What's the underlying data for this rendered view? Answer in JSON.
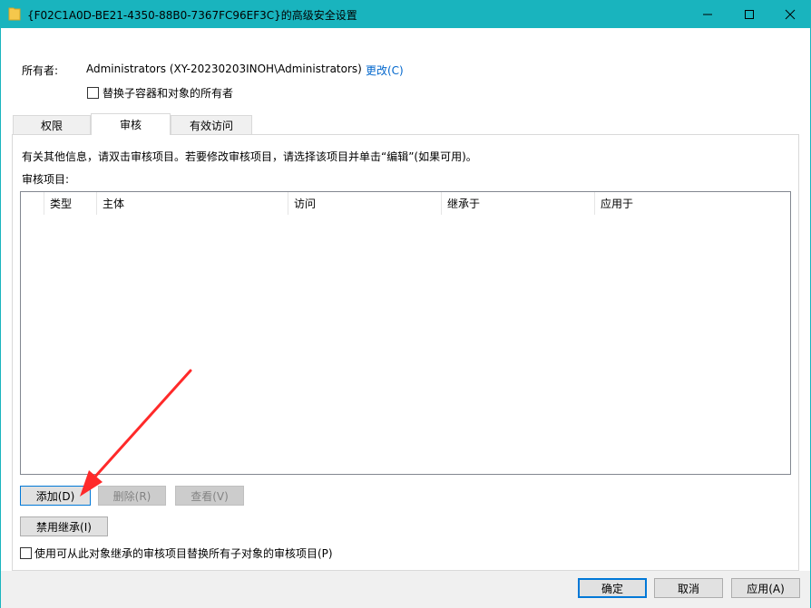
{
  "window": {
    "title": "{F02C1A0D-BE21-4350-88B0-7367FC96EF3C}的高级安全设置",
    "icon": "folder-icon"
  },
  "owner": {
    "label": "所有者:",
    "value": "Administrators (XY-20230203INOH\\Administrators)",
    "change_label": "更改(C)",
    "replace_owner_label": "替换子容器和对象的所有者"
  },
  "tabs": [
    {
      "label": "权限"
    },
    {
      "label": "审核"
    },
    {
      "label": "有效访问"
    }
  ],
  "active_tab": "审核",
  "audit": {
    "info_text": "有关其他信息，请双击审核项目。若要修改审核项目，请选择该项目并单击“编辑”(如果可用)。",
    "list_label": "审核项目:",
    "columns": [
      "类型",
      "主体",
      "访问",
      "继承于",
      "应用于"
    ],
    "rows": [],
    "add_label": "添加(D)",
    "remove_label": "删除(R)",
    "view_label": "查看(V)",
    "disable_inherit_label": "禁用继承(I)",
    "replace_child_label": "使用可从此对象继承的审核项目替换所有子对象的审核项目(P)"
  },
  "footer": {
    "ok_label": "确定",
    "cancel_label": "取消",
    "apply_label": "应用(A)"
  },
  "colors": {
    "titlebar": "#19b4be",
    "focus": "#0078d7",
    "annotation_arrow": "#ff2a2a"
  }
}
